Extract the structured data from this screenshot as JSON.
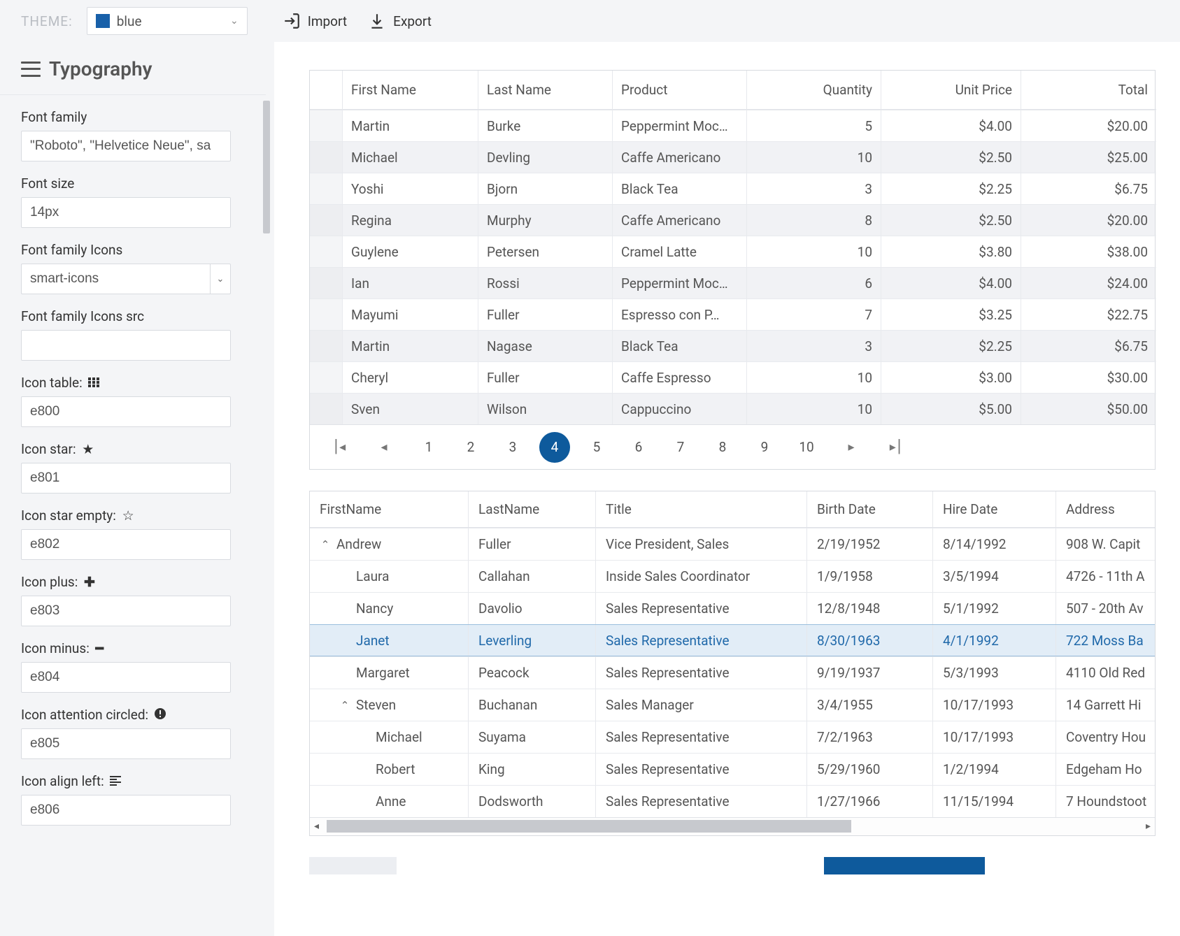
{
  "topbar": {
    "theme_label": "THEME:",
    "theme_name": "blue",
    "theme_color": "#1860a9",
    "import_label": "Import",
    "export_label": "Export"
  },
  "sidebar": {
    "title": "Typography",
    "fields": {
      "font_family": {
        "label": "Font family",
        "value": "\"Roboto\", \"Helvetice Neue\", sa"
      },
      "font_size": {
        "label": "Font size",
        "value": "14px"
      },
      "font_family_icons": {
        "label": "Font family Icons",
        "value": "smart-icons"
      },
      "font_family_icons_src": {
        "label": "Font family Icons src",
        "value": ""
      },
      "icon_table": {
        "label": "Icon table:",
        "value": "e800",
        "glyph": "⠿"
      },
      "icon_star": {
        "label": "Icon star:",
        "value": "e801",
        "glyph": "★"
      },
      "icon_star_empty": {
        "label": "Icon star empty:",
        "value": "e802",
        "glyph": "☆"
      },
      "icon_plus": {
        "label": "Icon plus:",
        "value": "e803",
        "glyph": "✚"
      },
      "icon_minus": {
        "label": "Icon minus:",
        "value": "e804",
        "glyph": "━"
      },
      "icon_attention_circled": {
        "label": "Icon attention circled:",
        "value": "e805",
        "glyph": "❕"
      },
      "icon_align_left": {
        "label": "Icon align left:",
        "value": "e806",
        "glyph": "≡"
      }
    }
  },
  "grid1": {
    "headers": [
      "First Name",
      "Last Name",
      "Product",
      "Quantity",
      "Unit Price",
      "Total"
    ],
    "rows": [
      {
        "first": "Martin",
        "last": "Burke",
        "product": "Peppermint Moc…",
        "qty": "5",
        "price": "$4.00",
        "total": "$20.00"
      },
      {
        "first": "Michael",
        "last": "Devling",
        "product": "Caffe Americano",
        "qty": "10",
        "price": "$2.50",
        "total": "$25.00"
      },
      {
        "first": "Yoshi",
        "last": "Bjorn",
        "product": "Black Tea",
        "qty": "3",
        "price": "$2.25",
        "total": "$6.75"
      },
      {
        "first": "Regina",
        "last": "Murphy",
        "product": "Caffe Americano",
        "qty": "8",
        "price": "$2.50",
        "total": "$20.00"
      },
      {
        "first": "Guylene",
        "last": "Petersen",
        "product": "Cramel Latte",
        "qty": "10",
        "price": "$3.80",
        "total": "$38.00"
      },
      {
        "first": "Ian",
        "last": "Rossi",
        "product": "Peppermint Moc…",
        "qty": "6",
        "price": "$4.00",
        "total": "$24.00"
      },
      {
        "first": "Mayumi",
        "last": "Fuller",
        "product": "Espresso con P…",
        "qty": "7",
        "price": "$3.25",
        "total": "$22.75"
      },
      {
        "first": "Martin",
        "last": "Nagase",
        "product": "Black Tea",
        "qty": "3",
        "price": "$2.25",
        "total": "$6.75"
      },
      {
        "first": "Cheryl",
        "last": "Fuller",
        "product": "Caffe Espresso",
        "qty": "10",
        "price": "$3.00",
        "total": "$30.00"
      },
      {
        "first": "Sven",
        "last": "Wilson",
        "product": "Cappuccino",
        "qty": "10",
        "price": "$5.00",
        "total": "$50.00"
      }
    ],
    "pages": [
      "1",
      "2",
      "3",
      "4",
      "5",
      "6",
      "7",
      "8",
      "9",
      "10"
    ],
    "active_page": "4"
  },
  "grid2": {
    "headers": [
      "FirstName",
      "LastName",
      "Title",
      "Birth Date",
      "Hire Date",
      "Address"
    ],
    "rows": [
      {
        "indent": 0,
        "exp": true,
        "first": "Andrew",
        "last": "Fuller",
        "title": "Vice President, Sales",
        "birth": "2/19/1952",
        "hire": "8/14/1992",
        "addr": "908 W. Capit"
      },
      {
        "indent": 1,
        "exp": false,
        "first": "Laura",
        "last": "Callahan",
        "title": "Inside Sales Coordinator",
        "birth": "1/9/1958",
        "hire": "3/5/1994",
        "addr": "4726 - 11th A"
      },
      {
        "indent": 1,
        "exp": false,
        "first": "Nancy",
        "last": "Davolio",
        "title": "Sales Representative",
        "birth": "12/8/1948",
        "hire": "5/1/1992",
        "addr": "507 - 20th Av"
      },
      {
        "indent": 1,
        "exp": false,
        "selected": true,
        "first": "Janet",
        "last": "Leverling",
        "title": "Sales Representative",
        "birth": "8/30/1963",
        "hire": "4/1/1992",
        "addr": "722 Moss Ba"
      },
      {
        "indent": 1,
        "exp": false,
        "first": "Margaret",
        "last": "Peacock",
        "title": "Sales Representative",
        "birth": "9/19/1937",
        "hire": "5/3/1993",
        "addr": "4110 Old Red"
      },
      {
        "indent": 1,
        "exp": true,
        "first": "Steven",
        "last": "Buchanan",
        "title": "Sales Manager",
        "birth": "3/4/1955",
        "hire": "10/17/1993",
        "addr": "14 Garrett Hi"
      },
      {
        "indent": 2,
        "exp": false,
        "first": "Michael",
        "last": "Suyama",
        "title": "Sales Representative",
        "birth": "7/2/1963",
        "hire": "10/17/1993",
        "addr": "Coventry Hou"
      },
      {
        "indent": 2,
        "exp": false,
        "first": "Robert",
        "last": "King",
        "title": "Sales Representative",
        "birth": "5/29/1960",
        "hire": "1/2/1994",
        "addr": "Edgeham Ho"
      },
      {
        "indent": 2,
        "exp": false,
        "first": "Anne",
        "last": "Dodsworth",
        "title": "Sales Representative",
        "birth": "1/27/1966",
        "hire": "11/15/1994",
        "addr": "7 Houndstoot"
      }
    ]
  }
}
